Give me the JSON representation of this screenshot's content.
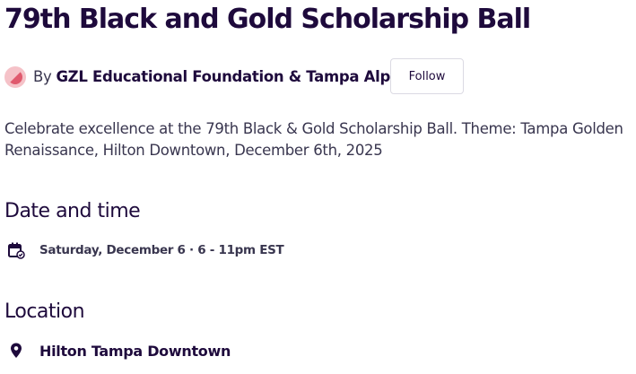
{
  "event": {
    "title": "79th Black and Gold Scholarship Ball",
    "summary": "Celebrate excellence at the 79th Black & Gold Scholarship Ball. Theme: Tampa Golden Renaissance, Hilton Downtown, December 6th, 2025"
  },
  "organizer": {
    "by_label": "By",
    "name": "GZL Educational Foundation & Tampa Alphas",
    "follow_label": "Follow"
  },
  "date_time": {
    "heading": "Date and time",
    "value": "Saturday, December 6 · 6 - 11pm EST",
    "icon": "calendar-check-icon"
  },
  "location": {
    "heading": "Location",
    "venue": "Hilton Tampa Downtown",
    "icon": "map-pin-icon"
  },
  "colors": {
    "heading": "#1e0a3c",
    "body_text": "#39364f",
    "avatar_accent": "#e05a6e"
  }
}
